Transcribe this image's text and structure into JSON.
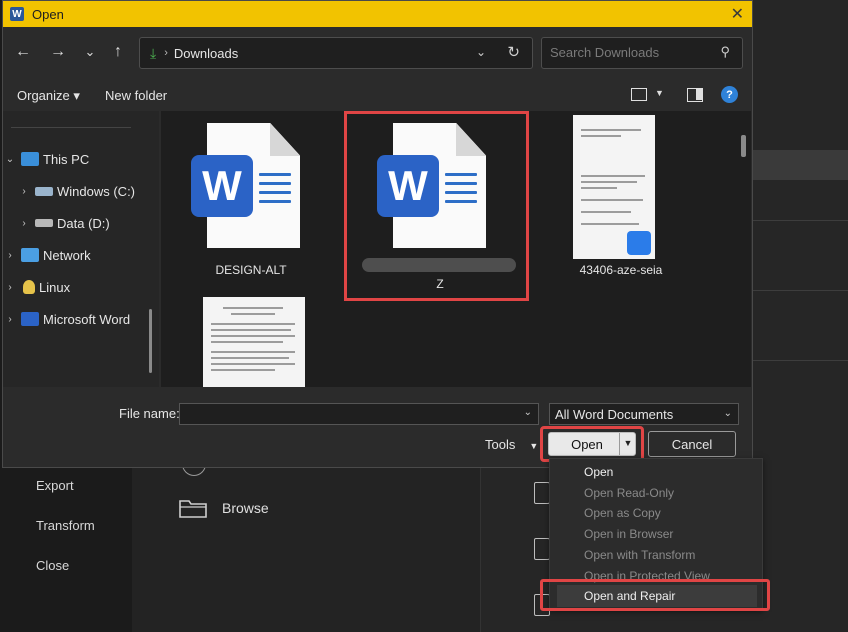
{
  "dialog": {
    "title": "Open",
    "close_glyph": "✕"
  },
  "nav": {
    "back": "←",
    "forward": "→",
    "recent": "⌄",
    "up": "↑",
    "path": "Downloads",
    "path_sep": "›",
    "refresh": "↻",
    "search_placeholder": "Search Downloads"
  },
  "commands": {
    "organize": "Organize ▾",
    "new_folder": "New folder",
    "help": "?"
  },
  "tree": [
    {
      "label": "This PC",
      "arrow": "⌄"
    },
    {
      "label": "Windows (C:)",
      "arrow": "›"
    },
    {
      "label": "Data (D:)",
      "arrow": "›"
    },
    {
      "label": "Network",
      "arrow": "›"
    },
    {
      "label": "Linux",
      "arrow": "›"
    },
    {
      "label": "Microsoft Word",
      "arrow": "›"
    }
  ],
  "files": [
    {
      "name": "DESIGN-ALT",
      "type": "word"
    },
    {
      "name": "Z",
      "type": "word"
    },
    {
      "name": "43406-aze-seia",
      "type": "pdf"
    }
  ],
  "footer": {
    "file_name_label": "File name:",
    "file_name_value": "",
    "file_type": "All Word Documents",
    "tools": "Tools",
    "open": "Open",
    "cancel": "Cancel"
  },
  "open_menu": [
    {
      "label": "Open",
      "enabled": true
    },
    {
      "label": "Open Read-Only",
      "enabled": false
    },
    {
      "label": "Open as Copy",
      "enabled": false
    },
    {
      "label": "Open in Browser",
      "enabled": false
    },
    {
      "label": "Open with Transform",
      "enabled": false
    },
    {
      "label": "Open in Protected View",
      "enabled": false
    },
    {
      "label": "Open and Repair",
      "enabled": true
    }
  ],
  "backstage": {
    "export": "Export",
    "transform": "Transform",
    "close": "Close",
    "browse": "Browse"
  },
  "colors": {
    "title_bar": "#f2c300",
    "highlight": "#e04545",
    "word_blue": "#2b63c6"
  }
}
